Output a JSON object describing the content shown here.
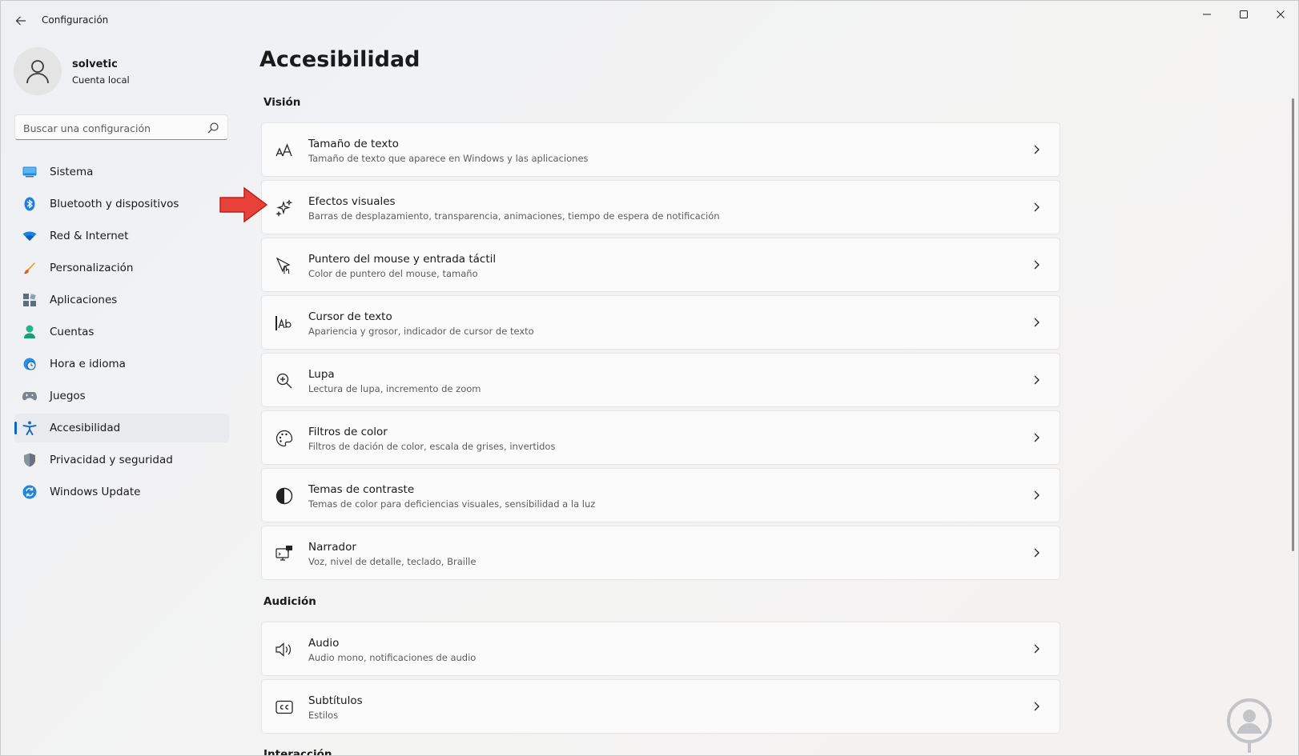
{
  "window": {
    "title": "Configuración"
  },
  "profile": {
    "name": "solvetic",
    "account_type": "Cuenta local"
  },
  "search": {
    "placeholder": "Buscar una configuración"
  },
  "nav": {
    "items": [
      {
        "label": "Sistema",
        "icon": "monitor-icon"
      },
      {
        "label": "Bluetooth y dispositivos",
        "icon": "bluetooth-icon"
      },
      {
        "label": "Red & Internet",
        "icon": "wifi-icon"
      },
      {
        "label": "Personalización",
        "icon": "brush-icon"
      },
      {
        "label": "Aplicaciones",
        "icon": "apps-icon"
      },
      {
        "label": "Cuentas",
        "icon": "person-icon"
      },
      {
        "label": "Hora e idioma",
        "icon": "globe-clock-icon"
      },
      {
        "label": "Juegos",
        "icon": "gamepad-icon"
      },
      {
        "label": "Accesibilidad",
        "icon": "accessibility-icon",
        "active": true
      },
      {
        "label": "Privacidad y seguridad",
        "icon": "shield-icon"
      },
      {
        "label": "Windows Update",
        "icon": "update-icon"
      }
    ]
  },
  "main": {
    "title": "Accesibilidad",
    "sections": [
      {
        "title": "Visión",
        "items": [
          {
            "title": "Tamaño de texto",
            "subtitle": "Tamaño de texto que aparece en Windows y las aplicaciones",
            "icon": "text-size-icon"
          },
          {
            "title": "Efectos visuales",
            "subtitle": "Barras de desplazamiento, transparencia, animaciones, tiempo de espera de notificación",
            "icon": "sparkle-icon"
          },
          {
            "title": "Puntero del mouse y entrada táctil",
            "subtitle": "Color de puntero del mouse, tamaño",
            "icon": "pointer-touch-icon"
          },
          {
            "title": "Cursor de texto",
            "subtitle": "Apariencia y grosor, indicador de cursor de texto",
            "icon": "text-cursor-icon"
          },
          {
            "title": "Lupa",
            "subtitle": "Lectura de lupa, incremento de zoom",
            "icon": "magnifier-icon"
          },
          {
            "title": "Filtros de color",
            "subtitle": "Filtros de dación de color, escala de grises, invertidos",
            "icon": "palette-icon"
          },
          {
            "title": "Temas de contraste",
            "subtitle": "Temas de color para deficiencias visuales, sensibilidad a la luz",
            "icon": "contrast-icon"
          },
          {
            "title": "Narrador",
            "subtitle": "Voz, nivel de detalle, teclado, Braille",
            "icon": "narrator-icon"
          }
        ]
      },
      {
        "title": "Audición",
        "items": [
          {
            "title": "Audio",
            "subtitle": "Audio mono, notificaciones de audio",
            "icon": "speaker-icon"
          },
          {
            "title": "Subtítulos",
            "subtitle": "Estilos",
            "icon": "closed-captions-icon"
          }
        ]
      },
      {
        "title": "Interacción"
      }
    ]
  },
  "colors": {
    "accent": "#0a67c4",
    "arrow": "#e8413a"
  }
}
